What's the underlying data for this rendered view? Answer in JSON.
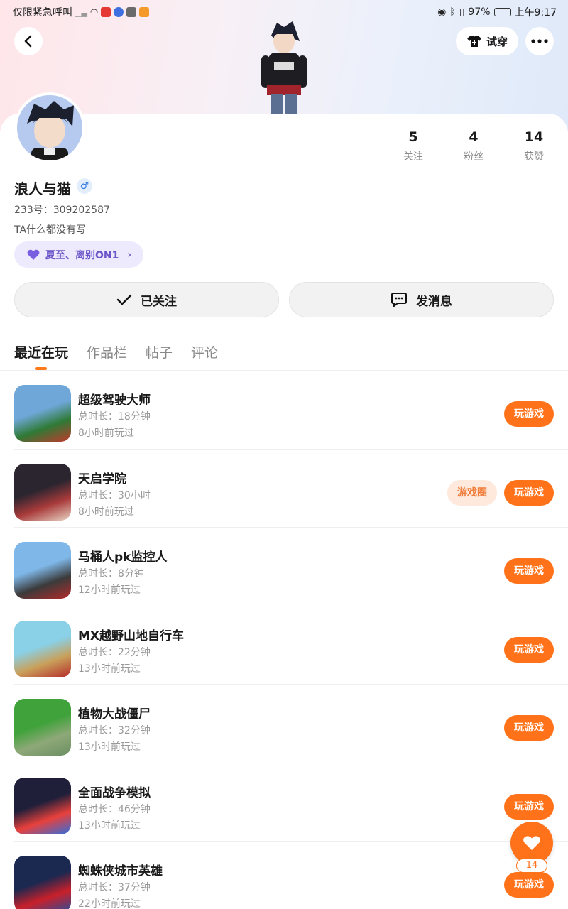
{
  "status_bar": {
    "carrier_text": "仅限紧急呼叫",
    "battery": "97%",
    "time": "上午9:17"
  },
  "header": {
    "try_on_label": "试穿"
  },
  "profile": {
    "stats": [
      {
        "value": "5",
        "label": "关注"
      },
      {
        "value": "4",
        "label": "粉丝"
      },
      {
        "value": "14",
        "label": "获赞"
      }
    ],
    "name": "浪人与猫",
    "gender_symbol": "♂",
    "uid": "233号：309202587",
    "bio": "TA什么都没有写",
    "tag": "夏至、离别ON1"
  },
  "actions": {
    "follow_label": "已关注",
    "message_label": "发消息"
  },
  "tabs": [
    "最近在玩",
    "作品栏",
    "帖子",
    "评论"
  ],
  "games": [
    {
      "title": "超级驾驶大师",
      "duration": "总时长：18分钟",
      "last_played": "8小时前玩过",
      "play": "玩游戏",
      "colors": [
        "#6fa7d9",
        "#2f7a36",
        "#c0392b"
      ]
    },
    {
      "title": "天启学院",
      "duration": "总时长：30小时",
      "last_played": "8小时前玩过",
      "play": "玩游戏",
      "circle": "游戏圈",
      "colors": [
        "#2b2530",
        "#a83a3a",
        "#e8d3c4"
      ]
    },
    {
      "title": "马桶人pk监控人",
      "duration": "总时长：8分钟",
      "last_played": "12小时前玩过",
      "play": "玩游戏",
      "colors": [
        "#7fb7e8",
        "#3b3b3b",
        "#b22a2a"
      ]
    },
    {
      "title": "MX越野山地自行车",
      "duration": "总时长：22分钟",
      "last_played": "13小时前玩过",
      "play": "玩游戏",
      "colors": [
        "#8ad0e6",
        "#c9a05a",
        "#b52a2a"
      ]
    },
    {
      "title": "植物大战僵尸",
      "duration": "总时长：32分钟",
      "last_played": "13小时前玩过",
      "play": "玩游戏",
      "colors": [
        "#3fa23a",
        "#8ea878",
        "#6b8f62"
      ]
    },
    {
      "title": "全面战争模拟",
      "duration": "总时长：46分钟",
      "last_played": "13小时前玩过",
      "play": "玩游戏",
      "colors": [
        "#1f1f3a",
        "#e8403b",
        "#2f6fe0"
      ]
    },
    {
      "title": "蜘蛛侠城市英雄",
      "duration": "总时长：37分钟",
      "last_played": "22小时前玩过",
      "play": "玩游戏",
      "colors": [
        "#1b2850",
        "#c8202a",
        "#2a4c9c"
      ]
    }
  ],
  "like": {
    "count": "14"
  }
}
